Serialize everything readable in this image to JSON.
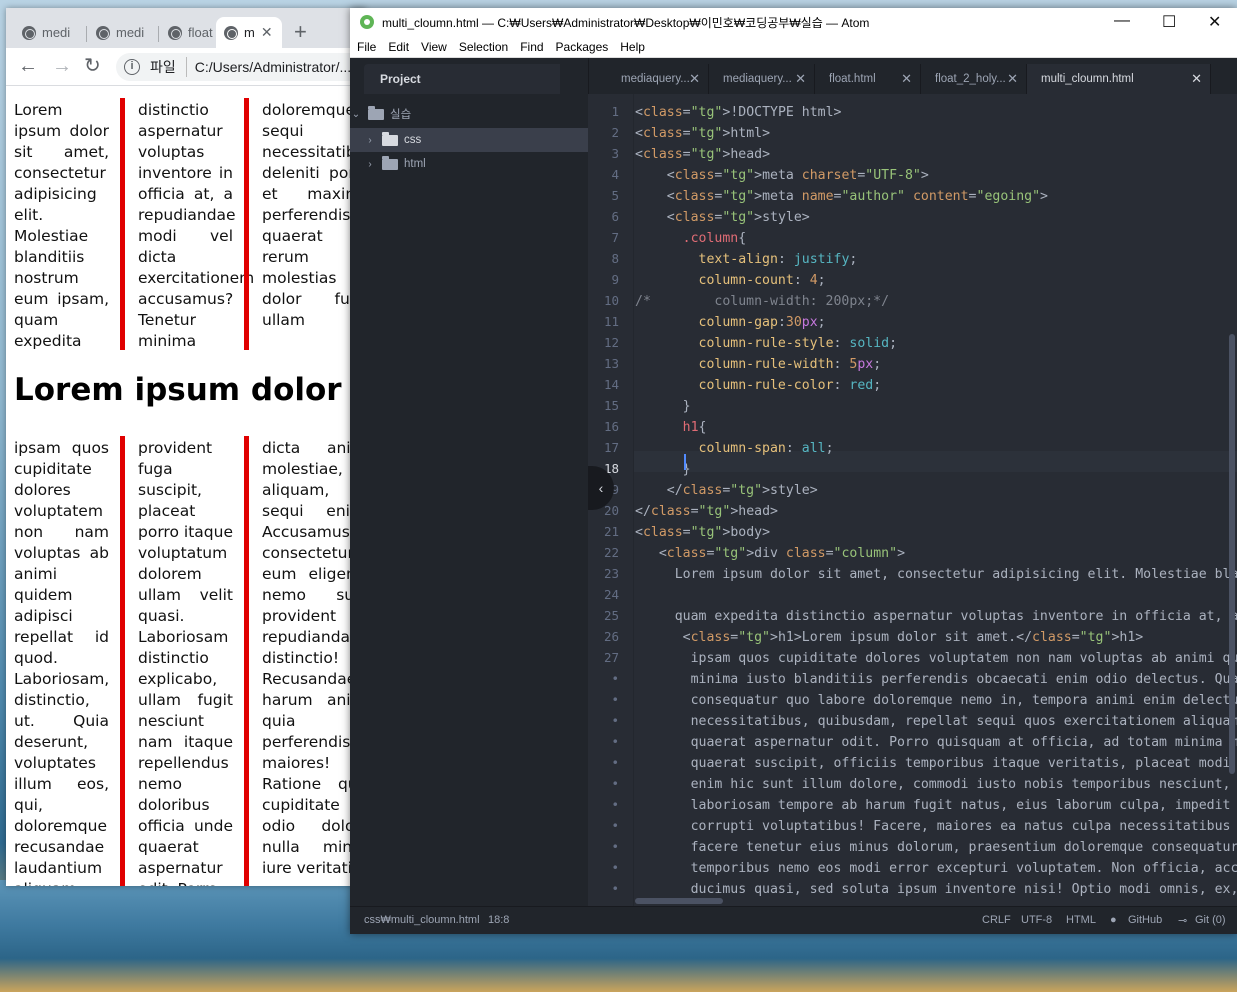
{
  "browser": {
    "tabs": [
      {
        "label": "medi"
      },
      {
        "label": "medi"
      },
      {
        "label": "float"
      },
      {
        "label": "m"
      }
    ],
    "file_label": "파일",
    "url": "C:/Users/Administrator/...",
    "page": {
      "columns_top": [
        "Lorem ipsum dolor sit amet, consectetur adipisicing elit. Molestiae blanditiis nostrum eum ipsam, quam expedita",
        "distinctio aspernatur voluptas inventore in officia at, a repudiandae modi vel dicta exercitationem accusamus? Tenetur minima",
        "doloremque sequi id necessitatibus deleniti porro et maxime perferendis quaerat rerum molestias dolor fugit ullam"
      ],
      "heading": "Lorem ipsum dolor sit amet.",
      "columns_bottom": [
        "ipsam quos cupiditate dolores voluptatem non nam voluptas ab animi quidem adipisci repellat id quod. Laboriosam, distinctio, ut. Quia deserunt, voluptates illum eos, qui, doloremque recusandae laudantium aliquam",
        "provident fuga suscipit, placeat porro itaque voluptatum dolorem ullam velit quasi. Laboriosam distinctio explicabo, ullam fugit nesciunt nam itaque repellendus nemo doloribus officia unde quaerat aspernatur odit. Porro",
        "dicta animi molestiae, aliquam, sequi enim. Accusamus consectetur eum eligendi nemo sunt provident ut repudiandae distinctio! Recusandae harum animi quia perferendis maiores! Ratione quis cupiditate odio dolore nulla minus iure veritatis"
      ]
    }
  },
  "atom": {
    "title": "multi_cloumn.html — C:₩Users₩Administrator₩Desktop₩이민호₩코딩공부₩실습 — Atom",
    "menu": [
      "File",
      "Edit",
      "View",
      "Selection",
      "Find",
      "Packages",
      "Help"
    ],
    "project_tab": "Project",
    "tree": {
      "root": "실습",
      "items": [
        "css",
        "html"
      ]
    },
    "tabs": [
      {
        "label": "mediaquery...."
      },
      {
        "label": "mediaquery..."
      },
      {
        "label": "float.html"
      },
      {
        "label": "float_2_holy..."
      },
      {
        "label": "multi_cloumn.html"
      }
    ],
    "gutter": [
      "1",
      "2",
      "3",
      "4",
      "5",
      "6",
      "7",
      "8",
      "9",
      "10",
      "11",
      "12",
      "13",
      "14",
      "15",
      "16",
      "17",
      "18",
      "19",
      "20",
      "21",
      "22",
      "23",
      "24",
      "25",
      "26",
      "27",
      "•",
      "•",
      "•",
      "•",
      "•",
      "•",
      "•",
      "•",
      "•",
      "•",
      "•",
      "•",
      "•",
      "•"
    ],
    "code_lines": [
      "<!DOCTYPE html>",
      "<html>",
      "<head>",
      "    <meta charset=\"UTF-8\">",
      "    <meta name=\"author\" content=\"egoing\">",
      "    <style>",
      "      .column{",
      "        text-align: justify;",
      "        column-count: 4;",
      "/*        column-width: 200px;*/",
      "        column-gap:30px;",
      "        column-rule-style: solid;",
      "        column-rule-width: 5px;",
      "        column-rule-color: red;",
      "      }",
      "      h1{",
      "        column-span: all;",
      "      }",
      "    </style>",
      "</head>",
      "<body>",
      "   <div class=\"column\">",
      "     Lorem ipsum dolor sit amet, consectetur adipisicing elit. Molestiae blan",
      "",
      "     quam expedita distinctio aspernatur voluptas inventore in officia at, a",
      "      <h1>Lorem ipsum dolor sit amet.</h1>",
      "       ipsam quos cupiditate dolores voluptatem non nam voluptas ab animi qui",
      "       minima iusto blanditiis perferendis obcaecati enim odio delectus. Quae",
      "       consequatur quo labore doloremque nemo in, tempora animi enim delectus ip",
      "       necessitatibus, quibusdam, repellat sequi quos exercitationem aliquam",
      "       quaerat aspernatur odit. Porro quisquam at officia, ad totam minima mi",
      "       quaerat suscipit, officiis temporibus itaque veritatis, placeat modi c",
      "       enim hic sunt illum dolore, commodi iusto nobis temporibus nesciunt, v",
      "       laboriosam tempore ab harum fugit natus, eius laborum culpa, impedit a",
      "       corrupti voluptatibus! Facere, maiores ea natus culpa necessitatibus t",
      "       facere tenetur eius minus dolorum, praesentium doloremque consequatur",
      "       temporibus nemo eos modi error excepturi voluptatem. Non officia, accu",
      "       ducimus quasi, sed soluta ipsum inventore nisi! Optio modi omnis, ex,"
    ],
    "status": {
      "path": "css₩multi_cloumn.html",
      "position": "18:8",
      "line_ending": "CRLF",
      "encoding": "UTF-8",
      "grammar": "HTML",
      "github": "GitHub",
      "git": "Git (0)"
    }
  }
}
